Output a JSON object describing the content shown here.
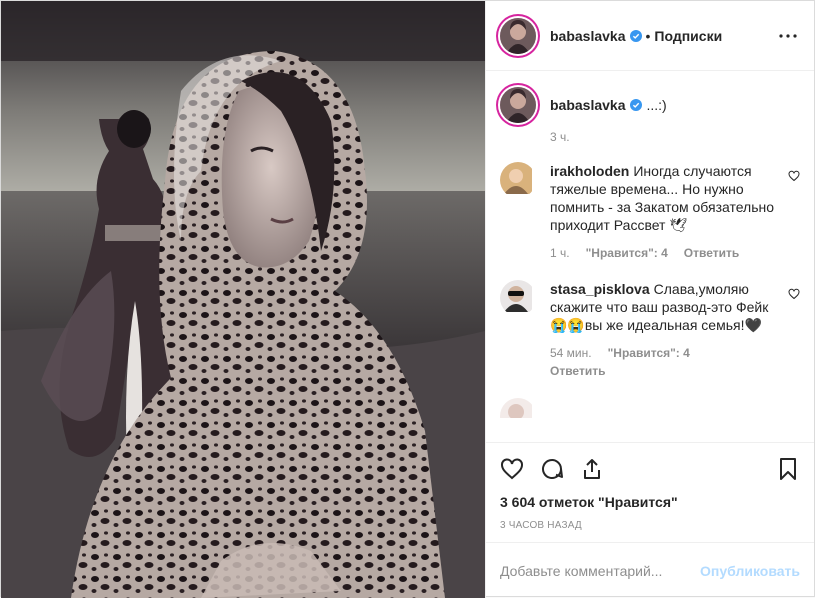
{
  "post": {
    "author": {
      "username": "babaslavka",
      "verified": true
    },
    "header": {
      "separator": "•",
      "follow_label": "Подписки",
      "more_icon": "more-horizontal-icon"
    },
    "caption": {
      "username": "babaslavka",
      "text": "...:)",
      "time": "3 ч."
    },
    "comments": [
      {
        "username": "irakholoden",
        "text": "Иногда случаются тяжелые времена... Но нужно помнить - за Закатом обязательно приходит Рассвет 🕊",
        "time": "1 ч.",
        "likes": "\"Нравится\": 4",
        "reply_label": "Ответить"
      },
      {
        "username": "stasa_pisklova",
        "text": "Слава,умоляю скажите что ваш развод-это Фейк😭😭вы же идеальная семья!🖤",
        "time": "54 мин.",
        "likes": "\"Нравится\": 4",
        "reply_label": "Ответить"
      }
    ],
    "actions": {
      "like_icon": "heart-icon",
      "comment_icon": "comment-icon",
      "share_icon": "share-icon",
      "save_icon": "bookmark-icon"
    },
    "likes_text": "3 604 отметок \"Нравится\"",
    "posted_ago": "3 ЧАСОВ НАЗАД",
    "add_comment": {
      "placeholder": "Добавьте комментарий...",
      "publish_label": "Опубликовать"
    },
    "colors": {
      "accent": "#3897f0",
      "publish_disabled": "#b3dbff",
      "muted": "#8e8e8e",
      "story_ring": "#d6249f"
    }
  }
}
